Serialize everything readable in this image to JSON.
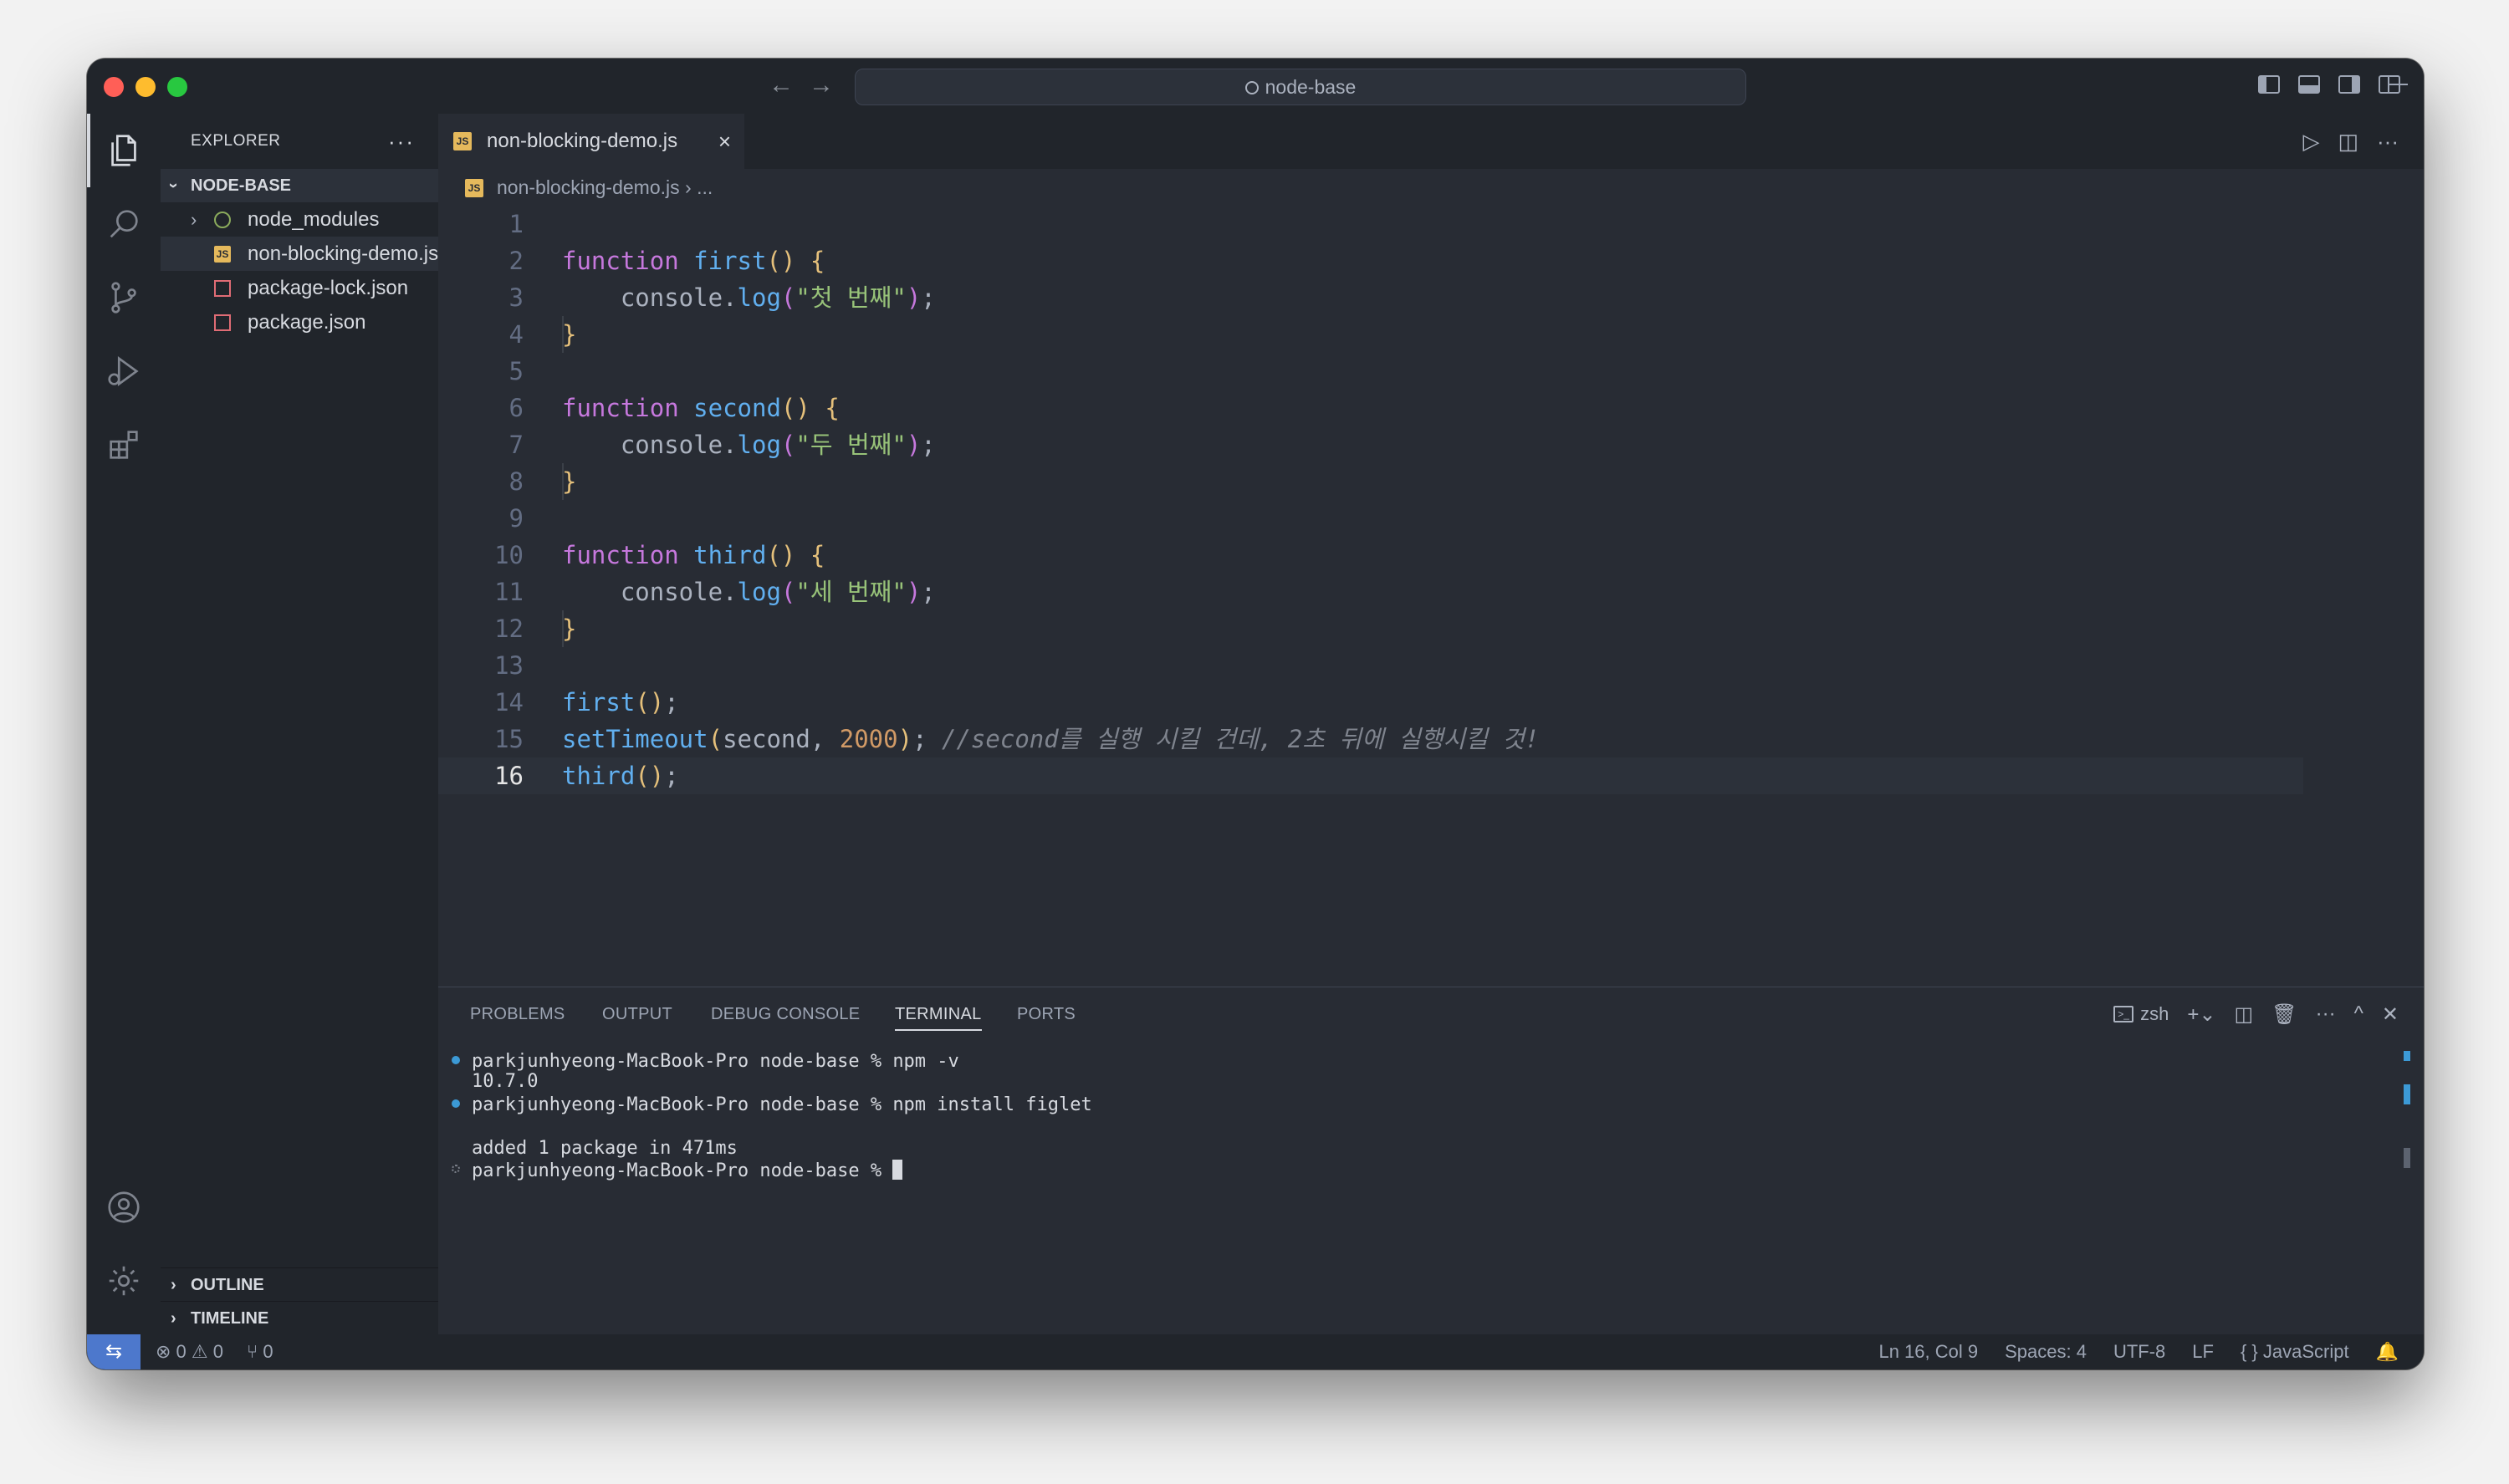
{
  "titlebar": {
    "search_text": "node-base"
  },
  "sidebar": {
    "title": "EXPLORER",
    "more": "···",
    "folder": "NODE-BASE",
    "items": [
      {
        "label": "node_modules",
        "icon": "npm-folder-icon"
      },
      {
        "label": "non-blocking-demo.js",
        "icon": "js-file-icon"
      },
      {
        "label": "package-lock.json",
        "icon": "json-file-icon"
      },
      {
        "label": "package.json",
        "icon": "json-file-icon"
      }
    ],
    "outline": "OUTLINE",
    "timeline": "TIMELINE"
  },
  "editor": {
    "tab_label": "non-blocking-demo.js",
    "breadcrumb_file": "non-blocking-demo.js",
    "breadcrumb_rest": "› ...",
    "current_line": 16
  },
  "panel": {
    "tabs": [
      "PROBLEMS",
      "OUTPUT",
      "DEBUG CONSOLE",
      "TERMINAL",
      "PORTS"
    ],
    "active_tab": "TERMINAL",
    "shell": "zsh",
    "terminal_lines": [
      "parkjunhyeong-MacBook-Pro node-base % npm -v",
      "10.7.0",
      "parkjunhyeong-MacBook-Pro node-base % npm install figlet",
      "added 1 package in 471ms",
      "parkjunhyeong-MacBook-Pro node-base % "
    ]
  },
  "statusbar": {
    "errors": "0",
    "warnings": "0",
    "ports": "0",
    "position": "Ln 16, Col 9",
    "spaces": "Spaces: 4",
    "encoding": "UTF-8",
    "eol": "LF",
    "language": "JavaScript"
  },
  "colors": {
    "background": "#282c34",
    "sidebar": "#21252b",
    "accent": "#4d78cc",
    "keyword": "#c678dd",
    "function": "#61afef",
    "string": "#98c379",
    "number": "#d19a66"
  }
}
